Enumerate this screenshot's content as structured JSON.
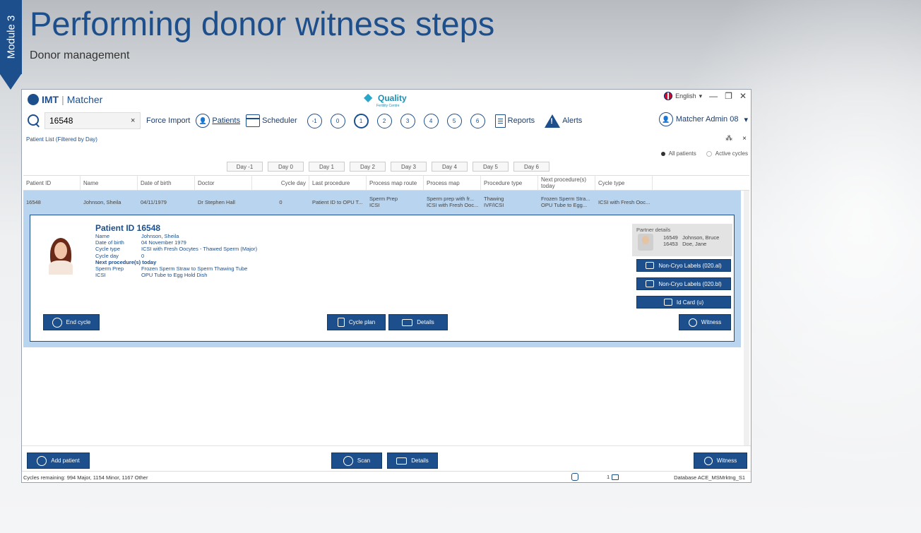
{
  "slide": {
    "module_label": "Module 3",
    "title": "Performing donor witness steps",
    "subtitle": "Donor management"
  },
  "app": {
    "brand_left": "IMT",
    "brand_right": "Matcher",
    "center_logo": "Quality",
    "center_logo_sub": "Fertility Centre",
    "language": "English",
    "window_minimize": "—",
    "window_restore": "❐",
    "window_close": "✕"
  },
  "toolbar": {
    "search_value": "16548",
    "clear_label": "×",
    "force_import": "Force Import",
    "patients": "Patients",
    "scheduler": "Scheduler",
    "day_circles": [
      "-1",
      "0",
      "1",
      "2",
      "3",
      "4",
      "5",
      "6"
    ],
    "reports": "Reports",
    "alerts": "Alerts",
    "user": "Matcher Admin 08",
    "user_chevron": "▾"
  },
  "list": {
    "title": "Patient List (Filtered by Day)",
    "pin": "⁂",
    "close": "×",
    "radio_all": "All patients",
    "radio_active": "Active cycles",
    "day_filters": [
      "Day -1",
      "Day 0",
      "Day 1",
      "Day 2",
      "Day 3",
      "Day 4",
      "Day 5",
      "Day 6"
    ],
    "columns": [
      "Patient ID",
      "Name",
      "Date of birth",
      "Doctor",
      "Cycle day",
      "Last procedure",
      "Process map route",
      "Process map",
      "Procedure type",
      "Next procedure(s) today",
      "Cycle type"
    ],
    "row": {
      "patient_id": "16548",
      "name": "Johnson, Sheila",
      "dob": "04/11/1979",
      "doctor": "Dr Stephen Hall",
      "cycle_day": "0",
      "last_procedure": "Patient ID to OPU T...",
      "route_1": "Sperm Prep",
      "route_2": "ICSI",
      "map_1": "Sperm prep with fr...",
      "map_2": "ICSI with Fresh Ooc...",
      "proc_1": "Thawing",
      "proc_2": "IVF/ICSI",
      "next_1": "Frozen Sperm Stra...",
      "next_2": "OPU Tube to Egg...",
      "cycle_type": "ICSI with Fresh Ooc..."
    }
  },
  "detail": {
    "title": "Patient ID 16548",
    "fields": [
      {
        "k": "Name",
        "v": "Johnson, Sheila"
      },
      {
        "k": "Date of birth",
        "v": "04 November 1979"
      },
      {
        "k": "Cycle type",
        "v": "ICSI with Fresh Oocytes - Thawed Sperm (Major)"
      },
      {
        "k": "Cycle day",
        "v": "0"
      }
    ],
    "next_header": "Next procedure(s) today",
    "next": [
      {
        "k": "Sperm Prep",
        "v": "Frozen Sperm Straw to Sperm Thawing Tube"
      },
      {
        "k": "ICSI",
        "v": "OPU Tube to Egg Hold Dish"
      }
    ],
    "partner_title": "Partner details",
    "partners": [
      {
        "id": "16549",
        "name": "Johnson, Bruce"
      },
      {
        "id": "16453",
        "name": "Doe, Jane"
      }
    ],
    "btn_noncryo_a": "Non-Cryo Labels (020.al)",
    "btn_noncryo_b": "Non-Cryo Labels (020.bl)",
    "btn_idcard": "Id Card (u)",
    "btn_witness": "Witness",
    "btn_end_cycle": "End cycle",
    "btn_cycle_plan": "Cycle plan",
    "btn_details": "Details"
  },
  "footer": {
    "add_patient": "Add patient",
    "scan": "Scan",
    "details": "Details",
    "witness": "Witness"
  },
  "status": {
    "cycles_remaining": "Cycles remaining: 994 Major, 1154 Minor, 1167 Other",
    "count": "1",
    "database": "Database  ACE_MSMrktng_S1"
  }
}
